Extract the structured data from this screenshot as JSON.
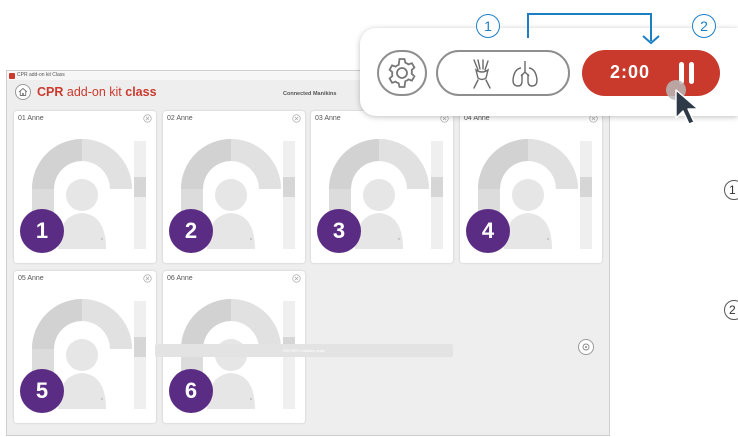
{
  "window": {
    "title": "CPR add-on kit Class"
  },
  "header": {
    "brand_part1": "CPR",
    "brand_part2": " add-on kit ",
    "brand_part3": "class",
    "connected_label": "Connected Manikins"
  },
  "cards": [
    {
      "name": "01 Anne",
      "number": "1"
    },
    {
      "name": "02 Anne",
      "number": "2"
    },
    {
      "name": "03 Anne",
      "number": "3"
    },
    {
      "name": "04 Anne",
      "number": "4"
    },
    {
      "name": "05 Anne",
      "number": "5"
    },
    {
      "name": "06 Anne",
      "number": "6"
    }
  ],
  "bottom_bar": {
    "label": "REPORT  Initialize scale"
  },
  "toolbar": {
    "timer": "2:00"
  },
  "callouts": {
    "c1": "1",
    "c2": "2"
  },
  "right_edge": {
    "n1": "1",
    "n2": "2"
  },
  "colors": {
    "brand_red": "#cc3a2e",
    "badge_purple": "#5b2c83",
    "callout_blue": "#1c7fc4",
    "timer_red": "#c9392c"
  },
  "icons": [
    "home-icon",
    "close-icon",
    "settings-gear-icon",
    "hands-compression-icon",
    "lungs-icon",
    "pause-icon",
    "mouse-pointer-icon",
    "arrow-down-icon"
  ]
}
